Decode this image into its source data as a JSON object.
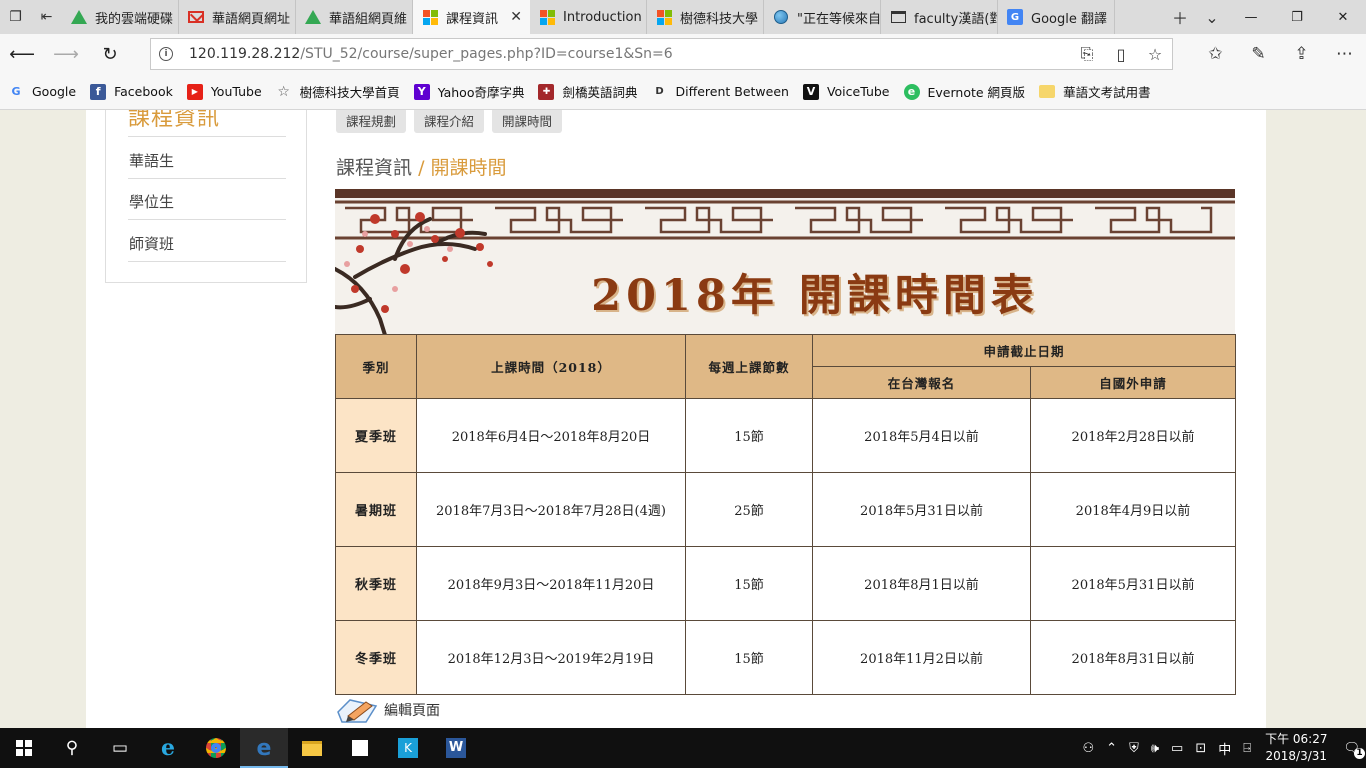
{
  "browser": {
    "tabs": [
      {
        "label": "我的雲端硬碟",
        "icon": "google-drive-icon"
      },
      {
        "label": "華語網頁網址",
        "icon": "gmail-icon"
      },
      {
        "label": "華語組網頁維",
        "icon": "google-drive-icon"
      },
      {
        "label": "課程資訊",
        "icon": "site-favicon-icon",
        "active": true
      },
      {
        "label": "Introduction",
        "icon": "site-favicon-icon"
      },
      {
        "label": "樹德科技大學",
        "icon": "site-favicon-icon"
      },
      {
        "label": "\"正在等候來自",
        "icon": "globe-icon"
      },
      {
        "label": "faculty漢語(對",
        "icon": "page-icon"
      },
      {
        "label": "Google 翻譯",
        "icon": "google-translate-icon"
      }
    ],
    "url": {
      "host": "120.119.28.212",
      "path": "/STU_52/course/super_pages.php?ID=course1&Sn=6"
    },
    "favorites": [
      {
        "label": "Google",
        "icon": "google-icon"
      },
      {
        "label": "Facebook",
        "icon": "facebook-icon"
      },
      {
        "label": "YouTube",
        "icon": "youtube-icon"
      },
      {
        "label": "樹德科技大學首頁",
        "icon": "star-icon"
      },
      {
        "label": "Yahoo奇摩字典",
        "icon": "yahoo-icon"
      },
      {
        "label": "劍橋英語詞典",
        "icon": "cambridge-icon"
      },
      {
        "label": "Different Between",
        "icon": "different-between-icon"
      },
      {
        "label": "VoiceTube",
        "icon": "voicetube-icon"
      },
      {
        "label": "Evernote 網頁版",
        "icon": "evernote-icon"
      },
      {
        "label": "華語文考試用書",
        "icon": "folder-icon"
      }
    ]
  },
  "sidebar": {
    "title": "課程資訊",
    "items": [
      "華語生",
      "學位生",
      "師資班"
    ]
  },
  "subtabs": [
    "課程規劃",
    "課程介紹",
    "開課時間"
  ],
  "breadcrumb": {
    "parent": "課程資訊",
    "separator": "/",
    "current": "開課時間"
  },
  "banner": {
    "title": "2018年  開課時間表"
  },
  "schedule": {
    "headers": {
      "season": "季別",
      "period": "上課時間（2018）",
      "weekly": "每週上課節數",
      "deadline": "申請截止日期",
      "taiwan": "在台灣報名",
      "abroad": "自國外申請"
    },
    "rows": [
      {
        "season": "夏季班",
        "period": "2018年6月4日～2018年8月20日",
        "weekly": "15節",
        "taiwan": "2018年5月4日以前",
        "abroad": "2018年2月28日以前"
      },
      {
        "season": "暑期班",
        "period": "2018年7月3日～2018年7月28日(4週)",
        "weekly": "25節",
        "taiwan": "2018年5月31日以前",
        "abroad": "2018年4月9日以前"
      },
      {
        "season": "秋季班",
        "period": "2018年9月3日～2018年11月20日",
        "weekly": "15節",
        "taiwan": "2018年8月1日以前",
        "abroad": "2018年5月31日以前"
      },
      {
        "season": "冬季班",
        "period": "2018年12月3日～2019年2月19日",
        "weekly": "15節",
        "taiwan": "2018年11月2日以前",
        "abroad": "2018年8月31日以前"
      }
    ]
  },
  "edit_label": "編輯頁面",
  "taskbar": {
    "ime": "中",
    "time": "下午 06:27",
    "date": "2018/3/31",
    "notifications": "1"
  },
  "colors": {
    "accent": "#d99b3c",
    "header_bg": "#dfb886",
    "season_bg": "#fce4c6",
    "banner_title": "#8a3a12"
  }
}
